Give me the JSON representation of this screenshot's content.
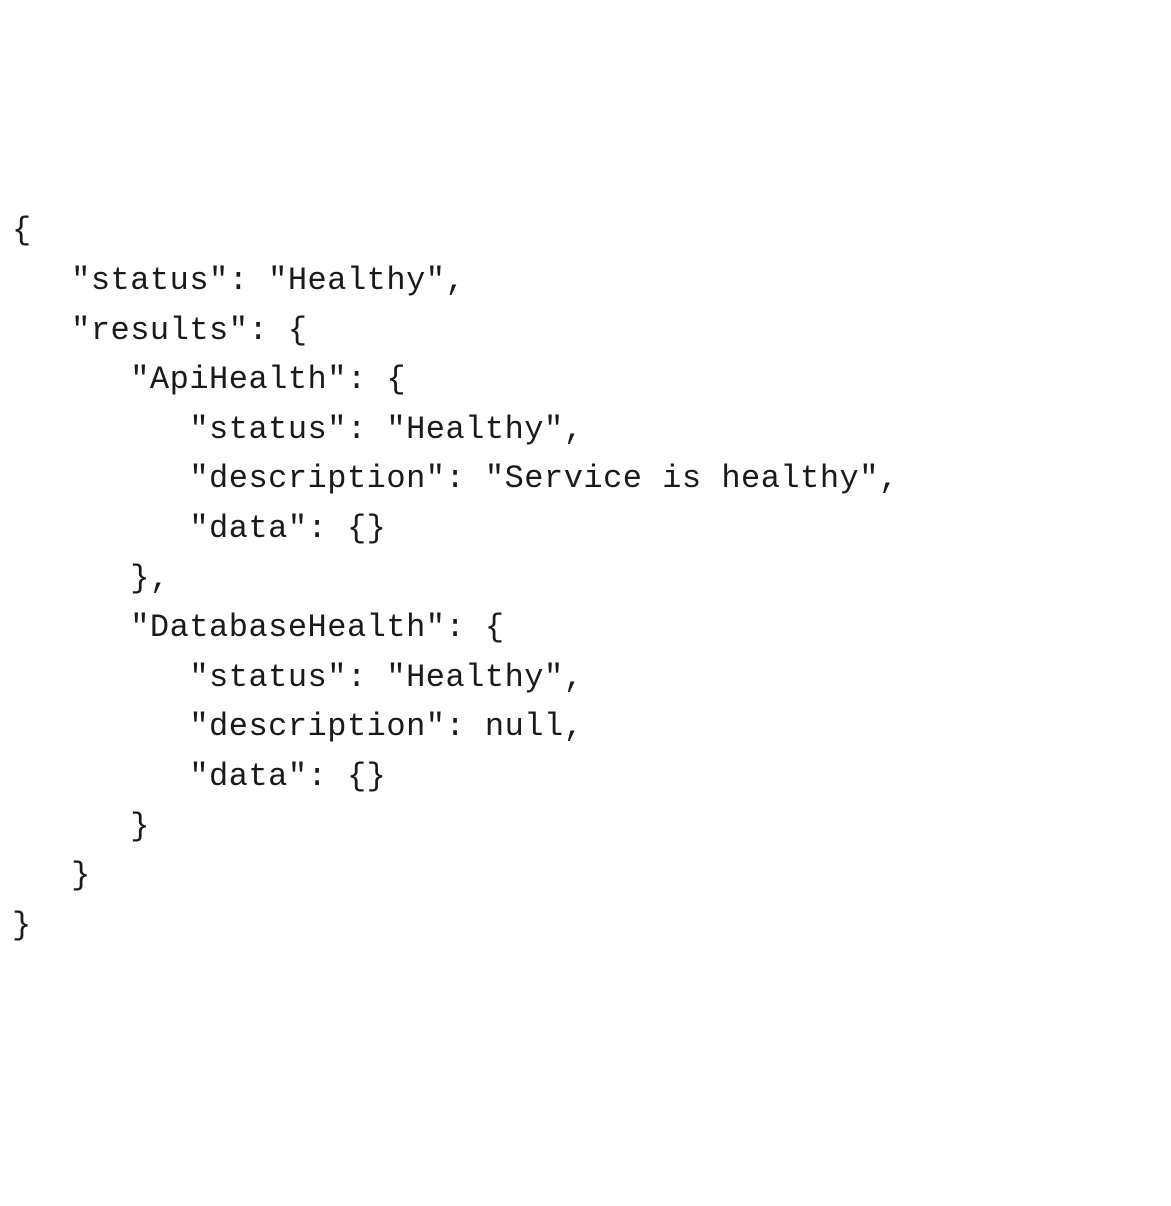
{
  "code": {
    "lines": [
      "{",
      "   \"status\": \"Healthy\",",
      "   \"results\": {",
      "      \"ApiHealth\": {",
      "         \"status\": \"Healthy\",",
      "         \"description\": \"Service is healthy\",",
      "         \"data\": {}",
      "      },",
      "      \"DatabaseHealth\": {",
      "         \"status\": \"Healthy\",",
      "         \"description\": null,",
      "         \"data\": {}",
      "      }",
      "   }",
      "}"
    ]
  }
}
